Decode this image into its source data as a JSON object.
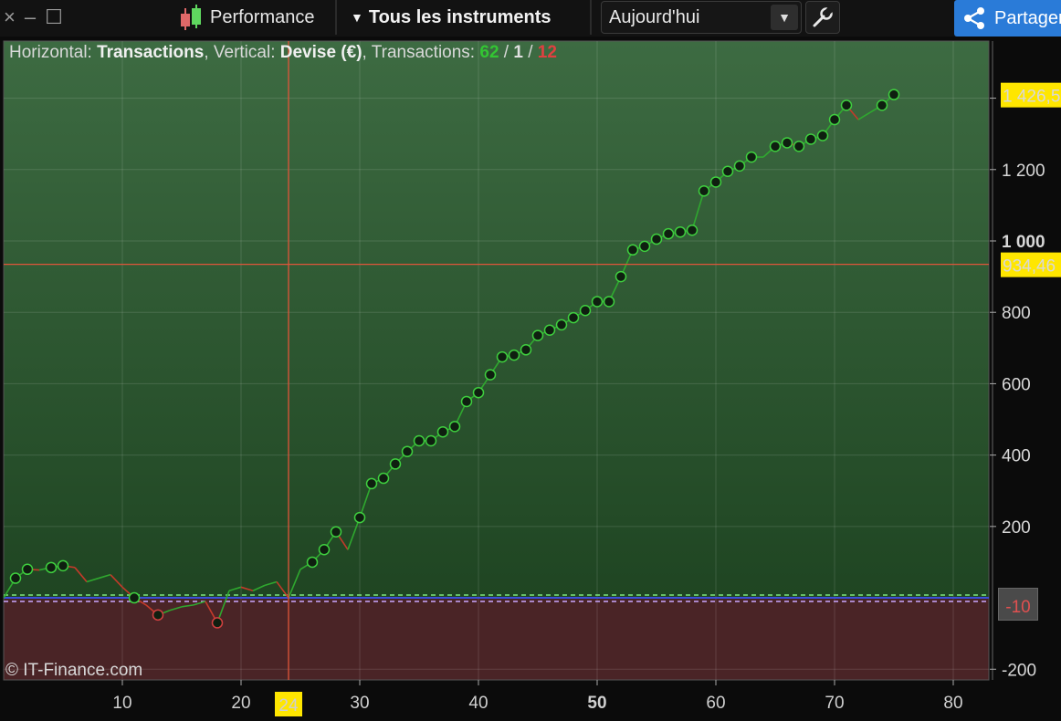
{
  "toolbar": {
    "close_icon": "×",
    "minimize_icon": "–",
    "maximize_icon": "☐",
    "performance_label": "Performance",
    "instruments_label": "Tous les instruments",
    "period_value": "Aujourd'hui",
    "share_label": "Partager"
  },
  "info": {
    "horizontal_label": "Horizontal: ",
    "horizontal_value": "Transactions",
    "vertical_label": ", Vertical: ",
    "vertical_value": "Devise (€)",
    "transactions_label": ", Transactions: ",
    "winners": "62",
    "neutral": "1",
    "losers": "12",
    "sep": " / "
  },
  "copyright": "© IT-Finance.com",
  "min_marker": "-10",
  "colors": {
    "positive_area": "#2f5f33",
    "negative_area": "#4a2426",
    "win_line": "#2fa82f",
    "loss_line": "#c43a2a",
    "cursor": "#e0553a",
    "label_yellow": "#ffe600"
  },
  "chart_data": {
    "type": "line",
    "xlabel": "",
    "ylabel": "",
    "xlim": [
      0,
      83
    ],
    "ylim": [
      -230,
      1560
    ],
    "x_ticks": [
      10,
      20,
      24,
      30,
      40,
      50,
      60,
      70,
      80
    ],
    "x_major_tick": 50,
    "y_ticks": [
      -200,
      200,
      400,
      600,
      800,
      1000,
      1200,
      1400
    ],
    "y_tick_labels": [
      "-200",
      "200",
      "400",
      "600",
      "800",
      "1 000",
      "1 200",
      "1 400"
    ],
    "y_major_tick": 1000,
    "grid": true,
    "crosshair": {
      "x": 24,
      "x_label": "24",
      "y": 934.46,
      "y_label": "934,46"
    },
    "last_value_label": "1 426,5",
    "zero_line": 0,
    "series": [
      {
        "x": [
          0,
          1,
          2,
          3,
          4,
          5,
          6,
          7,
          8,
          9,
          10,
          11,
          12,
          13,
          14,
          15,
          16,
          17,
          18,
          19,
          20,
          21,
          22,
          23,
          24,
          25,
          26,
          27,
          28,
          29,
          30,
          31,
          32,
          33,
          34,
          35,
          36,
          37,
          38,
          39,
          40,
          41,
          42,
          43,
          44,
          45,
          46,
          47,
          48,
          49,
          50,
          51,
          52,
          53,
          54,
          55,
          56,
          57,
          58,
          59,
          60,
          61,
          62,
          63,
          64,
          65,
          66,
          67,
          68,
          69,
          70,
          71,
          72,
          73,
          74,
          75
        ],
        "y": [
          0,
          55,
          80,
          78,
          85,
          90,
          85,
          45,
          55,
          65,
          30,
          0,
          -20,
          -48,
          -35,
          -25,
          -20,
          -10,
          -70,
          20,
          30,
          20,
          35,
          45,
          0,
          80,
          100,
          135,
          185,
          135,
          225,
          320,
          335,
          375,
          410,
          440,
          440,
          465,
          480,
          550,
          575,
          625,
          675,
          680,
          695,
          735,
          750,
          765,
          785,
          805,
          830,
          830,
          900,
          975,
          985,
          1005,
          1020,
          1025,
          1030,
          1140,
          1165,
          1195,
          1210,
          1235,
          1235,
          1265,
          1275,
          1265,
          1285,
          1295,
          1340,
          1380,
          1340,
          1360,
          1380,
          1410
        ]
      }
    ],
    "marked_points": [
      1,
      2,
      4,
      5,
      11,
      13,
      18,
      26,
      27,
      28,
      30,
      31,
      32,
      33,
      34,
      35,
      36,
      37,
      38,
      39,
      40,
      41,
      42,
      43,
      44,
      45,
      46,
      47,
      48,
      49,
      50,
      51,
      52,
      53,
      54,
      55,
      56,
      57,
      58,
      59,
      60,
      61,
      62,
      63,
      65,
      66,
      67,
      68,
      69,
      70,
      71,
      74,
      75
    ]
  }
}
